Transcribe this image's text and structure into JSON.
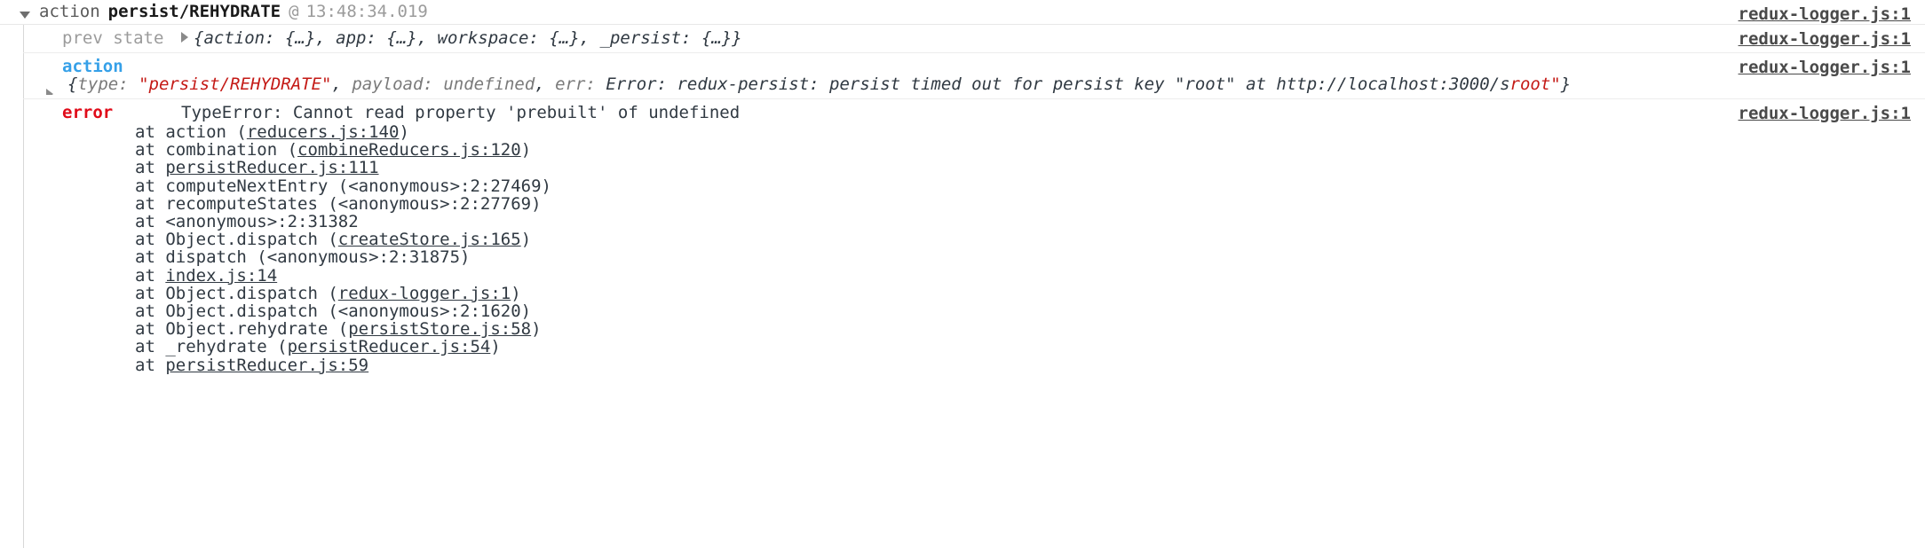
{
  "header": {
    "toggle_icon": "triangle-down-icon",
    "word": "action",
    "action_type": "persist/REHYDRATE",
    "at_symbol": "@",
    "timestamp": "13:48:34.019",
    "source_link": "redux-logger.js:1"
  },
  "prev_state": {
    "label": "prev state",
    "expand_icon": "triangle-right-icon",
    "value": "{action: {…}, app: {…}, workspace: {…}, _persist: {…}}",
    "source_link": "redux-logger.js:1"
  },
  "action": {
    "label": "action",
    "expand_icon": "triangle-right-icon",
    "source_link": "redux-logger.js:1",
    "value_parts": {
      "open_brace": "{",
      "key_type": "type:",
      "type_value": "\"persist/REHYDRATE\"",
      "comma1": ", ",
      "key_payload": "payload:",
      "payload_value": "undefined",
      "comma2": ", ",
      "key_err": "err:",
      "err_value": "Error: redux-persist: persist timed out for persist key",
      "err_key_quoted": "\"root\"",
      "err_at": "at",
      "err_url": "http://localhost:3000/s",
      "wrapped_tail_red": "root\"",
      "wrapped_tail_grey": "}"
    }
  },
  "error": {
    "label": "error",
    "message": "TypeError: Cannot read property 'prebuilt' of undefined",
    "source_link": "redux-logger.js:1",
    "stack": [
      {
        "prefix": "at action (",
        "link": "reducers.js:140",
        "suffix": ")"
      },
      {
        "prefix": "at combination (",
        "link": "combineReducers.js:120",
        "suffix": ")"
      },
      {
        "prefix": "at ",
        "link": "persistReducer.js:111",
        "suffix": ""
      },
      {
        "prefix": "at computeNextEntry (<anonymous>:2:27469)",
        "link": "",
        "suffix": ""
      },
      {
        "prefix": "at recomputeStates (<anonymous>:2:27769)",
        "link": "",
        "suffix": ""
      },
      {
        "prefix": "at <anonymous>:2:31382",
        "link": "",
        "suffix": ""
      },
      {
        "prefix": "at Object.dispatch (",
        "link": "createStore.js:165",
        "suffix": ")"
      },
      {
        "prefix": "at dispatch (<anonymous>:2:31875)",
        "link": "",
        "suffix": ""
      },
      {
        "prefix": "at ",
        "link": "index.js:14",
        "suffix": ""
      },
      {
        "prefix": "at Object.dispatch (",
        "link": "redux-logger.js:1",
        "suffix": ")"
      },
      {
        "prefix": "at Object.dispatch (<anonymous>:2:1620)",
        "link": "",
        "suffix": ""
      },
      {
        "prefix": "at Object.rehydrate (",
        "link": "persistStore.js:58",
        "suffix": ")"
      },
      {
        "prefix": "at _rehydrate (",
        "link": "persistReducer.js:54",
        "suffix": ")"
      },
      {
        "prefix": "at ",
        "link": "persistReducer.js:59",
        "suffix": ""
      }
    ]
  },
  "colors": {
    "action_label": "#35a0e8",
    "error_label": "#e00b19",
    "string_red": "#c41a16",
    "text": "#303942",
    "muted": "#9b9b9b",
    "border": "#e8e8e8"
  }
}
